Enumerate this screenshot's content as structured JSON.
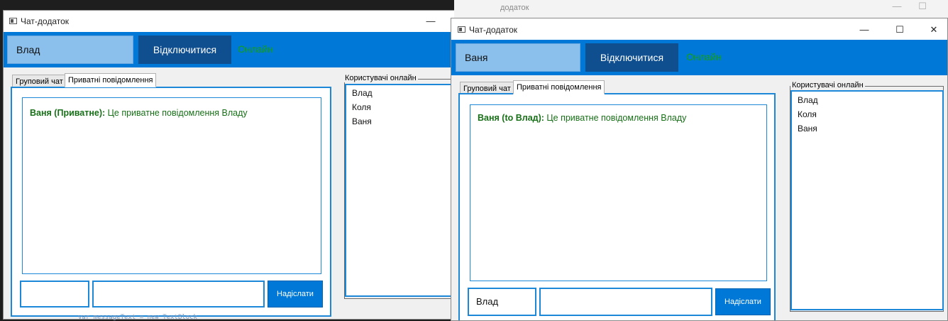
{
  "window1": {
    "title": "Чат-додаток",
    "username": "Влад",
    "disconnect_label": "Відключитися",
    "status": "Онлайн",
    "tabs": [
      "Груповий чат",
      "Приватні повідомлення"
    ],
    "message": {
      "sender": "Ваня (Приватне):",
      "text": " Це приватне повідомлення Владу"
    },
    "recipient_value": "",
    "message_value": "",
    "send_label": "Надіслати",
    "users_legend": "Користувачі онлайн",
    "users": [
      "Влад",
      "Коля",
      "Ваня"
    ]
  },
  "window2": {
    "title": "Чат-додаток",
    "behind_title": "додаток",
    "username": "Ваня",
    "disconnect_label": "Відключитися",
    "status": "Онлайн",
    "tabs": [
      "Груповий чат",
      "Приватні повідомлення"
    ],
    "message": {
      "sender": "Ваня (to Влад):",
      "text": " Це приватне повідомлення Владу"
    },
    "recipient_value": "Влад",
    "message_value": "",
    "send_label": "Надіслати",
    "users_legend": "Користувачі онлайн",
    "users": [
      "Влад",
      "Коля",
      "Ваня"
    ]
  },
  "background_code": "var messageText = new TextBlock",
  "icons": {
    "minimize": "minimize-icon",
    "maximize": "maximize-icon",
    "close": "close-icon"
  },
  "colors": {
    "accent": "#0078d7",
    "status": "#14a014",
    "private_message": "#177017"
  }
}
